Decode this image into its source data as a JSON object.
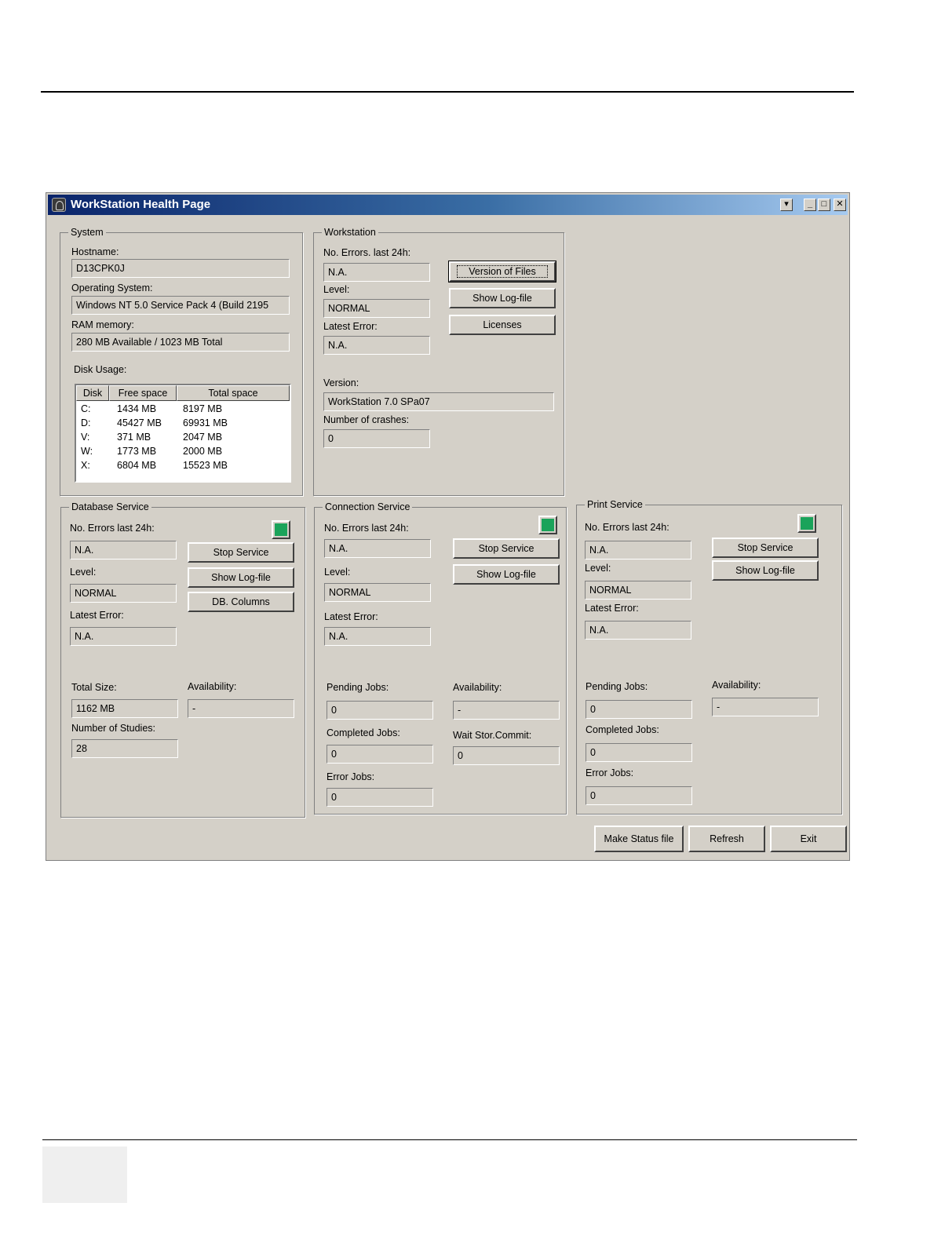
{
  "window": {
    "title": "WorkStation Health Page"
  },
  "system": {
    "legend": "System",
    "hostname_label": "Hostname:",
    "hostname": "D13CPK0J",
    "os_label": "Operating System:",
    "os": "Windows NT 5.0 Service Pack 4 (Build 2195",
    "ram_label": "RAM memory:",
    "ram": "280 MB Available / 1023 MB Total",
    "disk_label": "Disk Usage:",
    "disk_columns": [
      "Disk",
      "Free space",
      "Total space"
    ],
    "disks": [
      {
        "disk": "C:",
        "free": "1434 MB",
        "total": "8197 MB"
      },
      {
        "disk": "D:",
        "free": "45427 MB",
        "total": "69931 MB"
      },
      {
        "disk": "V:",
        "free": "371 MB",
        "total": "2047 MB"
      },
      {
        "disk": "W:",
        "free": "1773 MB",
        "total": "2000 MB"
      },
      {
        "disk": "X:",
        "free": "6804 MB",
        "total": "15523 MB"
      }
    ]
  },
  "workstation": {
    "legend": "Workstation",
    "errors_label": "No. Errors. last 24h:",
    "errors": "N.A.",
    "level_label": "Level:",
    "level": "NORMAL",
    "latest_error_label": "Latest Error:",
    "latest_error": "N.A.",
    "version_label": "Version:",
    "version": "WorkStation 7.0 SPa07",
    "crashes_label": "Number of crashes:",
    "crashes": "0",
    "btn_version_files": "Version of Files",
    "btn_show_log": "Show Log-file",
    "btn_licenses": "Licenses"
  },
  "database": {
    "legend": "Database Service",
    "errors_label": "No. Errors last 24h:",
    "errors": "N.A.",
    "level_label": "Level:",
    "level": "NORMAL",
    "latest_error_label": "Latest Error:",
    "latest_error": "N.A.",
    "total_size_label": "Total Size:",
    "total_size": "1162 MB",
    "availability_label": "Availability:",
    "availability": "-",
    "studies_label": "Number of Studies:",
    "studies": "28",
    "btn_stop": "Stop Service",
    "btn_show_log": "Show Log-file",
    "btn_db_columns": "DB. Columns",
    "status_color": "#1aa35a"
  },
  "connection": {
    "legend": "Connection Service",
    "errors_label": "No. Errors last 24h:",
    "errors": "N.A.",
    "level_label": "Level:",
    "level": "NORMAL",
    "latest_error_label": "Latest Error:",
    "latest_error": "N.A.",
    "pending_label": "Pending Jobs:",
    "pending": "0",
    "availability_label": "Availability:",
    "availability": "-",
    "completed_label": "Completed Jobs:",
    "completed": "0",
    "wait_label": "Wait Stor.Commit:",
    "wait": "0",
    "error_jobs_label": "Error Jobs:",
    "error_jobs": "0",
    "btn_stop": "Stop Service",
    "btn_show_log": "Show Log-file",
    "status_color": "#1aa35a"
  },
  "print": {
    "legend": "Print Service",
    "errors_label": "No. Errors last 24h:",
    "errors": "N.A.",
    "level_label": "Level:",
    "level": "NORMAL",
    "latest_error_label": "Latest Error:",
    "latest_error": "N.A.",
    "pending_label": "Pending Jobs:",
    "pending": "0",
    "availability_label": "Availability:",
    "availability": "-",
    "completed_label": "Completed Jobs:",
    "completed": "0",
    "error_jobs_label": "Error Jobs:",
    "error_jobs": "0",
    "btn_stop": "Stop Service",
    "btn_show_log": "Show Log-file",
    "status_color": "#1aa35a"
  },
  "footer_buttons": {
    "make_status": "Make Status file",
    "refresh": "Refresh",
    "exit": "Exit"
  }
}
